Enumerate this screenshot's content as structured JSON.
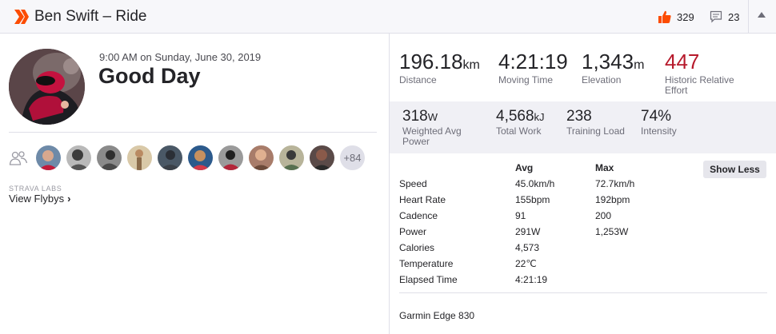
{
  "header": {
    "title": "Ben Swift – Ride",
    "kudos_count": "329",
    "comment_count": "23",
    "brand_color": "#fc4c02"
  },
  "activity": {
    "date_time": "9:00 AM on Sunday, June 30, 2019",
    "name": "Good Day"
  },
  "athletes": {
    "more_count": "+84"
  },
  "labs": {
    "label": "STRAVA LABS",
    "flybys": "View Flybys"
  },
  "stats_primary": [
    {
      "value": "196.18",
      "unit": "km",
      "label": "Distance"
    },
    {
      "value": "4:21:19",
      "unit": "",
      "label": "Moving Time"
    },
    {
      "value": "1,343",
      "unit": "m",
      "label": "Elevation"
    },
    {
      "value": "447",
      "unit": "",
      "label": "Historic Relative Effort",
      "color": "#b71a2c"
    }
  ],
  "stats_secondary": [
    {
      "value": "318",
      "unit": "W",
      "label": "Weighted Avg Power"
    },
    {
      "value": "4,568",
      "unit": "kJ",
      "label": "Total Work"
    },
    {
      "value": "238",
      "unit": "",
      "label": "Training Load"
    },
    {
      "value": "74%",
      "unit": "",
      "label": "Intensity"
    }
  ],
  "details": {
    "col_avg": "Avg",
    "col_max": "Max",
    "show_less": "Show Less",
    "rows": [
      {
        "label": "Speed",
        "avg": "45.0km/h",
        "max": "72.7km/h"
      },
      {
        "label": "Heart Rate",
        "avg": "155bpm",
        "max": "192bpm"
      },
      {
        "label": "Cadence",
        "avg": "91",
        "max": "200"
      },
      {
        "label": "Power",
        "avg": "291W",
        "max": "1,253W"
      },
      {
        "label": "Calories",
        "avg": "4,573",
        "max": ""
      },
      {
        "label": "Temperature",
        "avg": "22℃",
        "max": ""
      },
      {
        "label": "Elapsed Time",
        "avg": "4:21:19",
        "max": ""
      }
    ],
    "device": "Garmin Edge 830"
  }
}
